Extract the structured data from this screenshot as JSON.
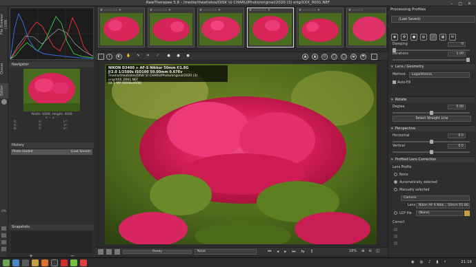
{
  "window": {
    "title": "RawTherapee 5.8 - /media/theatiatos/DISK \\U CHARU/Photo/original/2020 (3) orig/XXX_0001.NEF",
    "controls": "–  □  ✕"
  },
  "vtabs": {
    "file_browser": "File Browser (339)",
    "queue": "Queue",
    "editor": "Editor"
  },
  "left": {
    "navigator_title": "Navigator",
    "nav_size": "Width: 6008, Height: 4008",
    "nav_coords": "x: -- y: --",
    "nav_rows": [
      [
        "R:",
        "H:",
        "L*:"
      ],
      [
        "G:",
        "S:",
        "a*:"
      ],
      [
        "B:",
        "V:",
        "b*:"
      ]
    ],
    "history_title": "History",
    "history_row": {
      "label": "Photo loaded",
      "value": "(Last Saved)"
    },
    "snapshots_title": "Snapshots",
    "zoom_pct": "0%"
  },
  "editor": {
    "exif_line1": "NIKON D3400 + AF-S Nikkor 50mm f/1.8G",
    "exif_line2": "ƒ/2.0  1/2500s  ISO100  50.00mm  0.67Ev",
    "exif_line3": "/media/theatiatos/DISK \\U CHARU/Photo/original/2020 (3) orig/XXX_0001.NEF",
    "exif_line4": "24.1 MP (6008x4008)"
  },
  "bottombar": {
    "status": "Ready",
    "profile": "None",
    "zoom": "18%"
  },
  "right": {
    "title": "Processing Profiles",
    "profile": "(Last Saved)",
    "damping_label": "Damping",
    "damping_value": "0",
    "iterations_label": "Iterations",
    "iterations_value": "1.00",
    "lens_geometry_title": "Lens / Geometry",
    "method_label": "Method:",
    "method_value": "LogarithmicL",
    "autofill_label": "Auto-Fill",
    "rotate_title": "Rotate",
    "degree_label": "Degree",
    "degree_value": "0.00",
    "select_straight": "Select Straight Line",
    "perspective_title": "Perspective",
    "horizontal_label": "Horizontal",
    "horizontal_value": "0.0",
    "vertical_label": "Vertical",
    "vertical_value": "0.0",
    "plc_title": "Profiled Lens Correction",
    "lens_profile_label": "Lens Profile",
    "radio_none": "None",
    "radio_auto": "Automatically selected",
    "radio_manual": "Manually selected",
    "camera_value": "Camera",
    "lens_label": "Lens",
    "lens_value": "Nikon AF-S Nikk... 50mm f/1.8G",
    "lcp_label": "LCP file",
    "lcp_value": "(None)",
    "correct_label": "Correct"
  },
  "taskbar": {
    "clock": "21:16"
  },
  "colors": {
    "accent": "#c8325a",
    "panel": "#2e2e2e",
    "dark": "#1c1c1c"
  }
}
